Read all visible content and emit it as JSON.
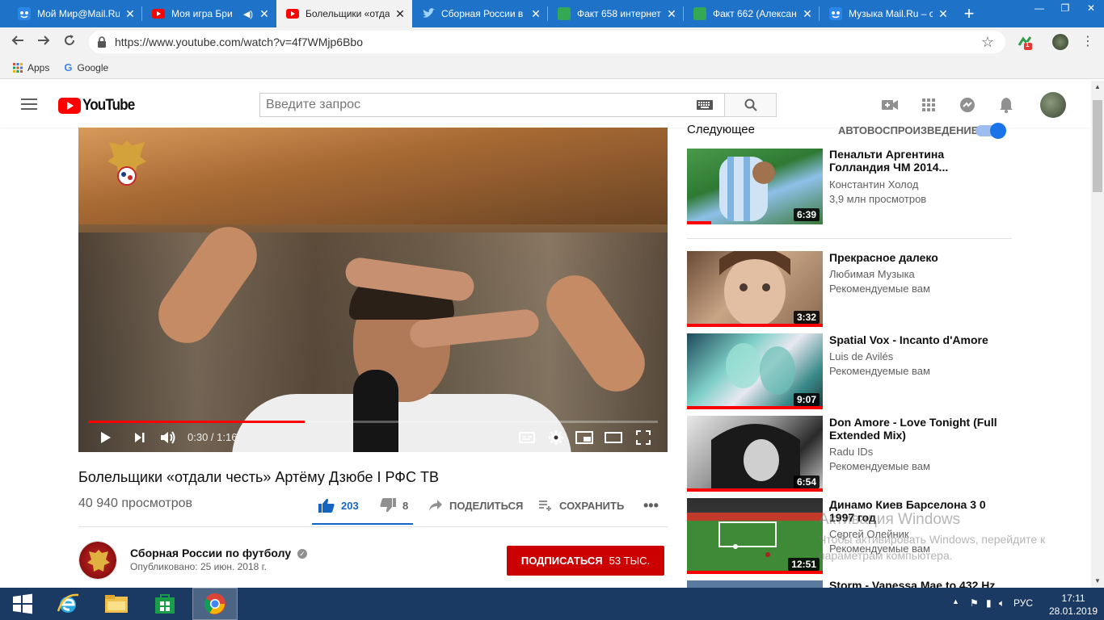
{
  "browser": {
    "tabs": [
      {
        "title": "Мой Мир@Mail.Ru",
        "icon": "mailru-icon"
      },
      {
        "title": "Моя игра Бри",
        "icon": "youtube-icon"
      },
      {
        "title": "Болельщики «отда",
        "icon": "youtube-icon",
        "active": true
      },
      {
        "title": "Сборная России в",
        "icon": "twitter-icon"
      },
      {
        "title": "Факт 658 интернет",
        "icon": "doc-icon"
      },
      {
        "title": "Факт 662 (Алексан",
        "icon": "doc-icon"
      },
      {
        "title": "Музыка Mail.Ru – с",
        "icon": "mailru-icon"
      }
    ],
    "new_tab": "+",
    "url": "https://www.youtube.com/watch?v=4f7WMjp6Bbo",
    "extension_badge": "1",
    "bookmarks": [
      {
        "label": "Apps",
        "icon": "apps-grid-icon"
      },
      {
        "label": "Google",
        "icon": "google-g-icon"
      }
    ]
  },
  "youtube": {
    "logo_text": "YouTube",
    "search_placeholder": "Введите запрос",
    "video": {
      "title": "Болельщики «отдали честь» Артёму Дзюбе I РФС ТВ",
      "views": "40 940 просмотров",
      "time": "0:30 / 1:16",
      "progress_played": 0.38,
      "progress_loaded": 0.39,
      "likes": "203",
      "dislikes": "8",
      "share_label": "ПОДЕЛИТЬСЯ",
      "save_label": "СОХРАНИТЬ"
    },
    "channel": {
      "name": "Сборная России по футболу",
      "published": "Опубликовано: 25 июн. 2018 г.",
      "subscribe_label": "ПОДПИСАТЬСЯ",
      "subscribers": "53 ТЫС."
    },
    "sidebar": {
      "next_label": "Следующее",
      "autoplay_label": "АВТОВОСПРОИЗВЕДЕНИЕ",
      "items": [
        {
          "title": "Пенальти Аргентина Голландия ЧМ 2014...",
          "channel": "Константин Холод",
          "meta": "3,9 млн просмотров",
          "duration": "6:39"
        },
        {
          "title": "Прекрасное далеко",
          "channel": "Любимая Музыка",
          "meta": "Рекомендуемые вам",
          "duration": "3:32"
        },
        {
          "title": "Spatial Vox - Incanto d'Amore",
          "channel": "Luis de Avilés",
          "meta": "Рекомендуемые вам",
          "duration": "9:07"
        },
        {
          "title": "Don Amore - Love Tonight (Full Extended Mix)",
          "channel": "Radu IDs",
          "meta": "Рекомендуемые вам",
          "duration": "6:54"
        },
        {
          "title": "Динамо Киев Барселона 3 0 1997 год",
          "channel": "Сергей Олейник",
          "meta": "Рекомендуемые вам",
          "duration": "12:51"
        },
        {
          "title": "Storm - Vanessa Mae to 432 Hz",
          "channel": "",
          "meta": "",
          "duration": ""
        }
      ]
    }
  },
  "watermark": {
    "line1": "Активация Windows",
    "line2": "Чтобы активировать Windows, перейдите к параметрам компьютера."
  },
  "taskbar": {
    "lang": "РУС",
    "time": "17:11",
    "date": "28.01.2019"
  },
  "colors": {
    "tabstrip": "#1e73c8",
    "youtube_red": "#ff0000",
    "subscribe_red": "#cc0000",
    "like_blue": "#1565c0",
    "taskbar": "#1b3a63"
  }
}
